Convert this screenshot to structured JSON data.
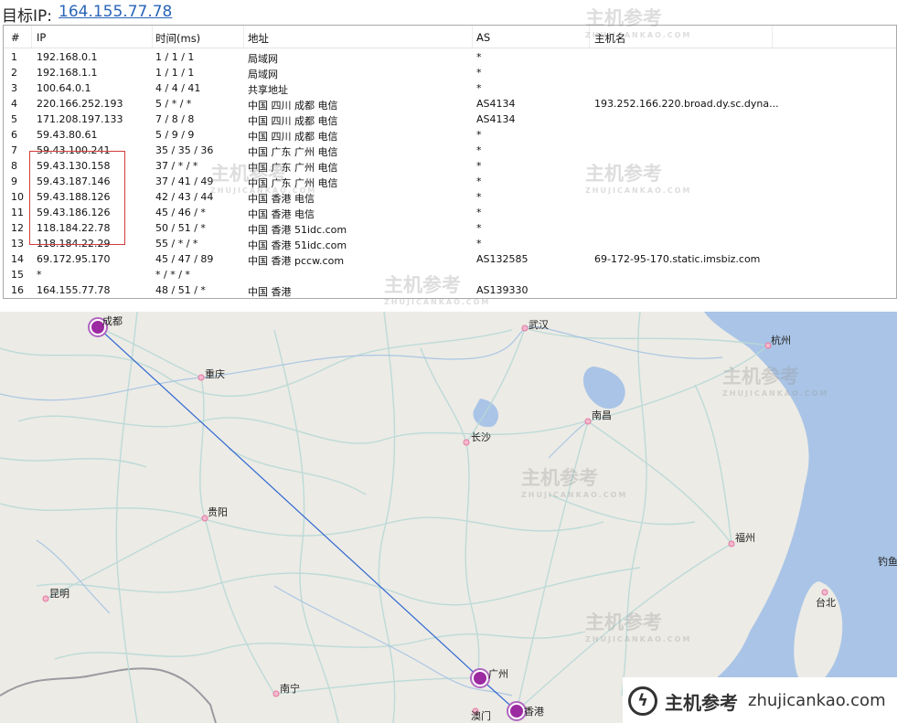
{
  "header": {
    "label": "目标IP:",
    "target_ip": "164.155.77.78"
  },
  "table": {
    "columns": [
      "#",
      "IP",
      "时间(ms)",
      "地址",
      "AS",
      "主机名"
    ],
    "rows": [
      {
        "num": "1",
        "ip": "192.168.0.1",
        "time": "1 / 1 / 1",
        "addr": "局域网",
        "as": "*",
        "host": ""
      },
      {
        "num": "2",
        "ip": "192.168.1.1",
        "time": "1 / 1 / 1",
        "addr": "局域网",
        "as": "*",
        "host": ""
      },
      {
        "num": "3",
        "ip": "100.64.0.1",
        "time": "4 / 4 / 41",
        "addr": "共享地址",
        "as": "*",
        "host": ""
      },
      {
        "num": "4",
        "ip": "220.166.252.193",
        "time": "5 / * / *",
        "addr": "中国 四川 成都 电信",
        "as": "AS4134",
        "host": "193.252.166.220.broad.dy.sc.dyna..."
      },
      {
        "num": "5",
        "ip": "171.208.197.133",
        "time": "7 / 8 / 8",
        "addr": "中国 四川 成都 电信",
        "as": "AS4134",
        "host": ""
      },
      {
        "num": "6",
        "ip": "59.43.80.61",
        "time": "5 / 9 / 9",
        "addr": "中国 四川 成都 电信",
        "as": "*",
        "host": ""
      },
      {
        "num": "7",
        "ip": "59.43.100.241",
        "time": "35 / 35 / 36",
        "addr": "中国 广东 广州 电信",
        "as": "*",
        "host": ""
      },
      {
        "num": "8",
        "ip": "59.43.130.158",
        "time": "37 / * / *",
        "addr": "中国 广东 广州 电信",
        "as": "*",
        "host": ""
      },
      {
        "num": "9",
        "ip": "59.43.187.146",
        "time": "37 / 41 / 49",
        "addr": "中国 广东 广州 电信",
        "as": "*",
        "host": ""
      },
      {
        "num": "10",
        "ip": "59.43.188.126",
        "time": "42 / 43 / 44",
        "addr": "中国 香港 电信",
        "as": "*",
        "host": ""
      },
      {
        "num": "11",
        "ip": "59.43.186.126",
        "time": "45 / 46 / *",
        "addr": "中国 香港 电信",
        "as": "*",
        "host": ""
      },
      {
        "num": "12",
        "ip": "118.184.22.78",
        "time": "50 / 51 / *",
        "addr": "中国 香港 51idc.com",
        "as": "*",
        "host": ""
      },
      {
        "num": "13",
        "ip": "118.184.22.29",
        "time": "55 / * / *",
        "addr": "中国 香港 51idc.com",
        "as": "*",
        "host": ""
      },
      {
        "num": "14",
        "ip": "69.172.95.170",
        "time": "45 / 47 / 89",
        "addr": "中国 香港 pccw.com",
        "as": "AS132585",
        "host": "69-172-95-170.static.imsbiz.com"
      },
      {
        "num": "15",
        "ip": "*",
        "time": "* / * / *",
        "addr": "",
        "as": "",
        "host": ""
      },
      {
        "num": "16",
        "ip": "164.155.77.78",
        "time": "48 / 51 / *",
        "addr": "中国 香港",
        "as": "AS139330",
        "host": ""
      }
    ]
  },
  "map": {
    "cities": [
      "成都",
      "武汉",
      "杭州",
      "重庆",
      "南昌",
      "长沙",
      "贵阳",
      "福州",
      "钓鱼",
      "昆明",
      "台北",
      "广州",
      "南宁",
      "澳门",
      "香港"
    ],
    "route_color": "#2f68d0",
    "marker_color": "#9c2aa0"
  },
  "watermark": {
    "logo_text": "主机参考",
    "logo_sub": "ZHUJICANKAO.COM",
    "footer_cn": "主机参考",
    "footer_domain": "zhujicankao.com"
  }
}
